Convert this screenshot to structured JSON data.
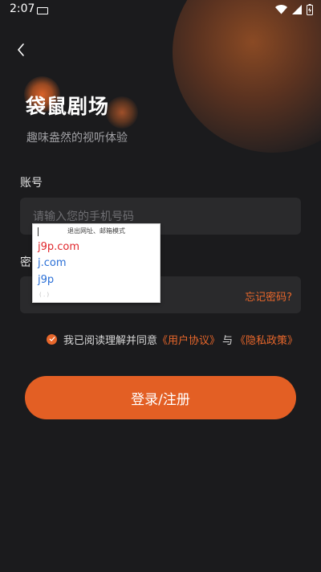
{
  "status_bar": {
    "time": "2:07"
  },
  "header": {
    "title": "袋鼠剧场",
    "subtitle": "趣味盎然的视听体验"
  },
  "account": {
    "label": "账号",
    "placeholder": "请输入您的手机号码"
  },
  "password": {
    "label": "密",
    "forgot_label": "忘记密码?"
  },
  "agreement": {
    "prefix": "我已阅读理解并同意",
    "user_agreement": "《用户协议》",
    "connector": "与",
    "privacy_policy": "《隐私政策》"
  },
  "login_button": {
    "label": "登录/注册"
  },
  "autofill_popup": {
    "header": "退出网址、邮箱模式",
    "suggestions": [
      {
        "text": "j9p.com",
        "color": "#e0262b"
      },
      {
        "text": "j.com",
        "color": "#2a6fd6"
      },
      {
        "text": "j9p",
        "color": "#2a6fd6"
      }
    ],
    "bottom_hint": "( . )"
  },
  "colors": {
    "accent": "#e35f24",
    "background": "#1b1b1d",
    "input_bg": "#2a2a2c"
  }
}
